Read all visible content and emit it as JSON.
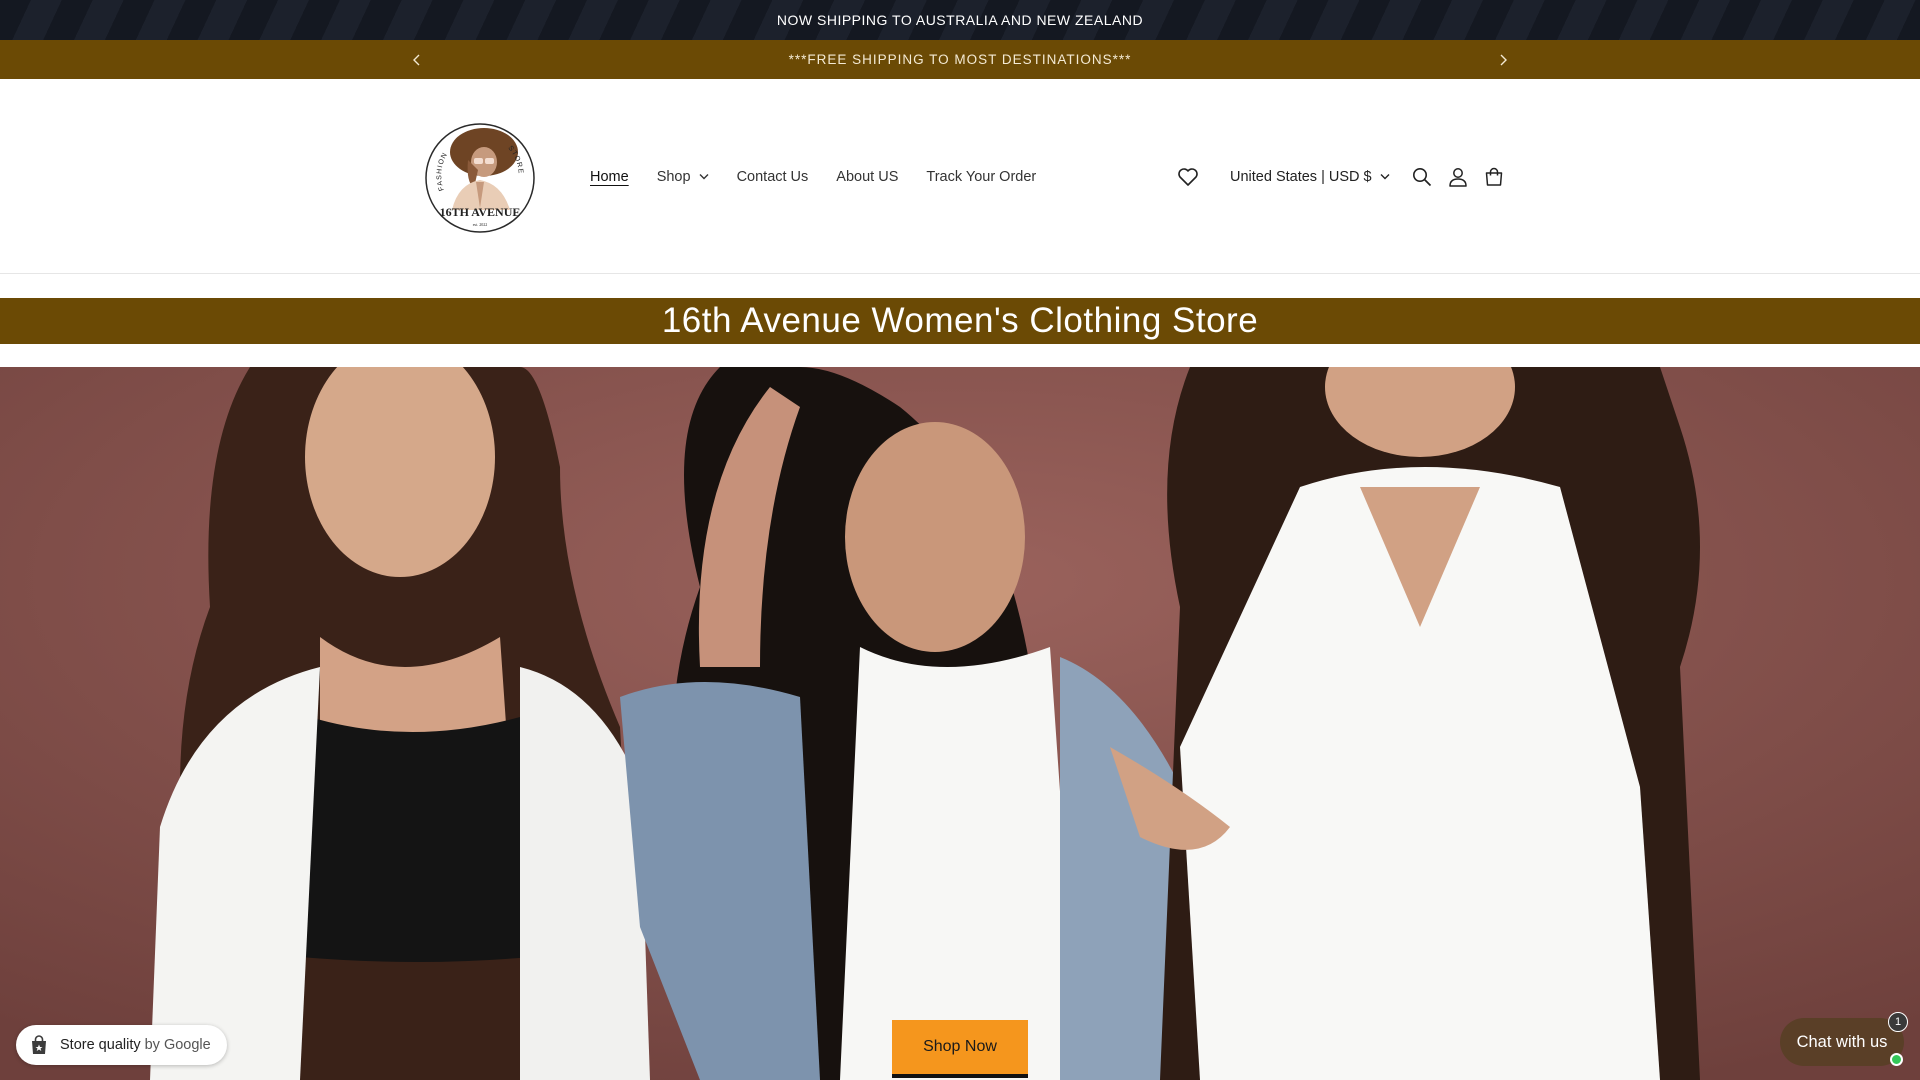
{
  "announcements": {
    "top": "NOW SHIPPING TO AUSTRALIA AND NEW ZEALAND",
    "carousel": "***FREE SHIPPING TO MOST DESTINATIONS***"
  },
  "header": {
    "logo": {
      "name": "16TH AVENUE",
      "left_arc": "FASHION",
      "right_arc": "STORE",
      "est": "est. 2022"
    },
    "nav": [
      {
        "label": "Home",
        "active": true
      },
      {
        "label": "Shop",
        "has_dropdown": true
      },
      {
        "label": "Contact Us"
      },
      {
        "label": "About US"
      },
      {
        "label": "Track Your Order"
      }
    ],
    "locale": "United States | USD $",
    "icons": [
      "heart-icon",
      "search-icon",
      "account-icon",
      "cart-icon"
    ]
  },
  "banner_title": "16th Avenue Women's Clothing Store",
  "hero": {
    "cta": "Shop Now"
  },
  "widgets": {
    "store_quality": {
      "label": "Store quality",
      "by": "by Google"
    },
    "chat": {
      "label": "Chat with us",
      "count": "1"
    }
  },
  "colors": {
    "brand_brown": "#6b4a05",
    "cta_orange": "#f5961d",
    "chat_brown": "#5a3f27"
  }
}
